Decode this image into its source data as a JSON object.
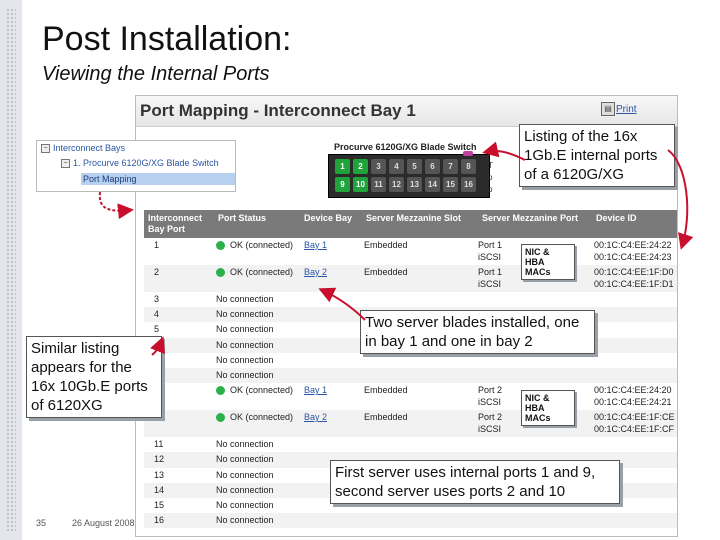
{
  "slide": {
    "title": "Post Installation:",
    "subtitle": "Viewing the Internal Ports",
    "page_number": "35",
    "date": "26 August 2008"
  },
  "screen": {
    "title": "Port Mapping - Interconnect Bay 1",
    "print_label": "Print",
    "tree": {
      "root": "Interconnect Bays",
      "child": "1. Procurve 6120G/XG Blade Switch",
      "selected": "Port Mapping"
    },
    "switch": {
      "label": "Procurve 6120G/XG Blade Switch",
      "top_row": [
        "1",
        "2",
        "3",
        "4",
        "5",
        "6",
        "7",
        "8"
      ],
      "bottom_row": [
        "9",
        "10",
        "11",
        "12",
        "13",
        "14",
        "15",
        "16"
      ],
      "side_labels": [
        "T",
        "o",
        "o"
      ]
    },
    "table": {
      "headers": [
        "Interconnect Bay Port",
        "Port Status",
        "Device Bay",
        "Server Mezzanine Slot",
        "Server Mezzanine Port",
        "Device ID"
      ],
      "rows": [
        {
          "port": "1",
          "status": "OK (connected)",
          "ok": true,
          "bay": "Bay 1",
          "slot": "Embedded",
          "mport": "Port 1",
          "mport2": "iSCSI",
          "id": "00:1C:C4:EE:24:22",
          "id2": "00:1C:C4:EE:24:23"
        },
        {
          "port": "2",
          "status": "OK (connected)",
          "ok": true,
          "bay": "Bay 2",
          "slot": "Embedded",
          "mport": "Port 1",
          "mport2": "iSCSI",
          "id": "00:1C:C4:EE:1F:D0",
          "id2": "00:1C:C4:EE:1F:D1"
        },
        {
          "port": "3",
          "status": "No connection"
        },
        {
          "port": "4",
          "status": "No connection"
        },
        {
          "port": "5",
          "status": "No connection"
        },
        {
          "port": "6",
          "status": "No connection"
        },
        {
          "port": "7",
          "status": "No connection"
        },
        {
          "port": "8",
          "status": "No connection"
        },
        {
          "port": "9",
          "status": "OK (connected)",
          "ok": true,
          "bay": "Bay 1",
          "slot": "Embedded",
          "mport": "Port 2",
          "mport2": "iSCSI",
          "id": "00:1C:C4:EE:24:20",
          "id2": "00:1C:C4:EE:24:21"
        },
        {
          "port": "10",
          "status": "OK (connected)",
          "ok": true,
          "bay": "Bay 2",
          "slot": "Embedded",
          "mport": "Port 2",
          "mport2": "iSCSI",
          "id": "00:1C:C4:EE:1F:CE",
          "id2": "00:1C:C4:EE:1F:CF"
        },
        {
          "port": "11",
          "status": "No connection"
        },
        {
          "port": "12",
          "status": "No connection"
        },
        {
          "port": "13",
          "status": "No connection"
        },
        {
          "port": "14",
          "status": "No connection"
        },
        {
          "port": "15",
          "status": "No connection"
        },
        {
          "port": "16",
          "status": "No connection"
        }
      ]
    }
  },
  "callouts": {
    "listing": "Listing of the 16x 1Gb.E internal ports of a 6120G/XG",
    "similar": "Similar listing appears for the 16x 10Gb.E ports of 6120XG",
    "two_blades": "Two server blades installed, one in bay 1 and one in bay 2",
    "first_server": "First server uses internal ports 1 and 9, second server uses ports 2 and 10",
    "nic1": "NIC & HBA MACs",
    "nic2": "NIC & HBA MACs"
  },
  "colors": {
    "ok_green": "#2bb04a",
    "port_green": "#1fa33a",
    "header_grey": "#7a7a7a",
    "link_blue": "#2a56a5",
    "arrow_red": "#c8102e"
  }
}
